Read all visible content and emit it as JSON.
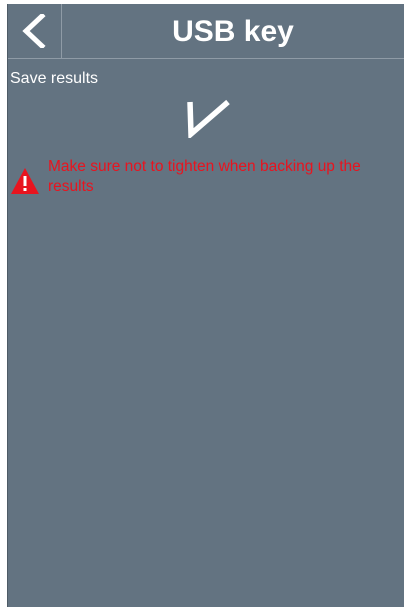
{
  "header": {
    "back_icon": "chevron-left-icon",
    "title": "USB key"
  },
  "content": {
    "save_label": "Save results",
    "status_icon": "checkmark-icon",
    "warning_icon": "warning-triangle-icon",
    "warning_text": "Make sure not to tighten when backing up the results"
  },
  "colors": {
    "background": "#637381",
    "text": "#ffffff",
    "warning": "#e8141f"
  }
}
